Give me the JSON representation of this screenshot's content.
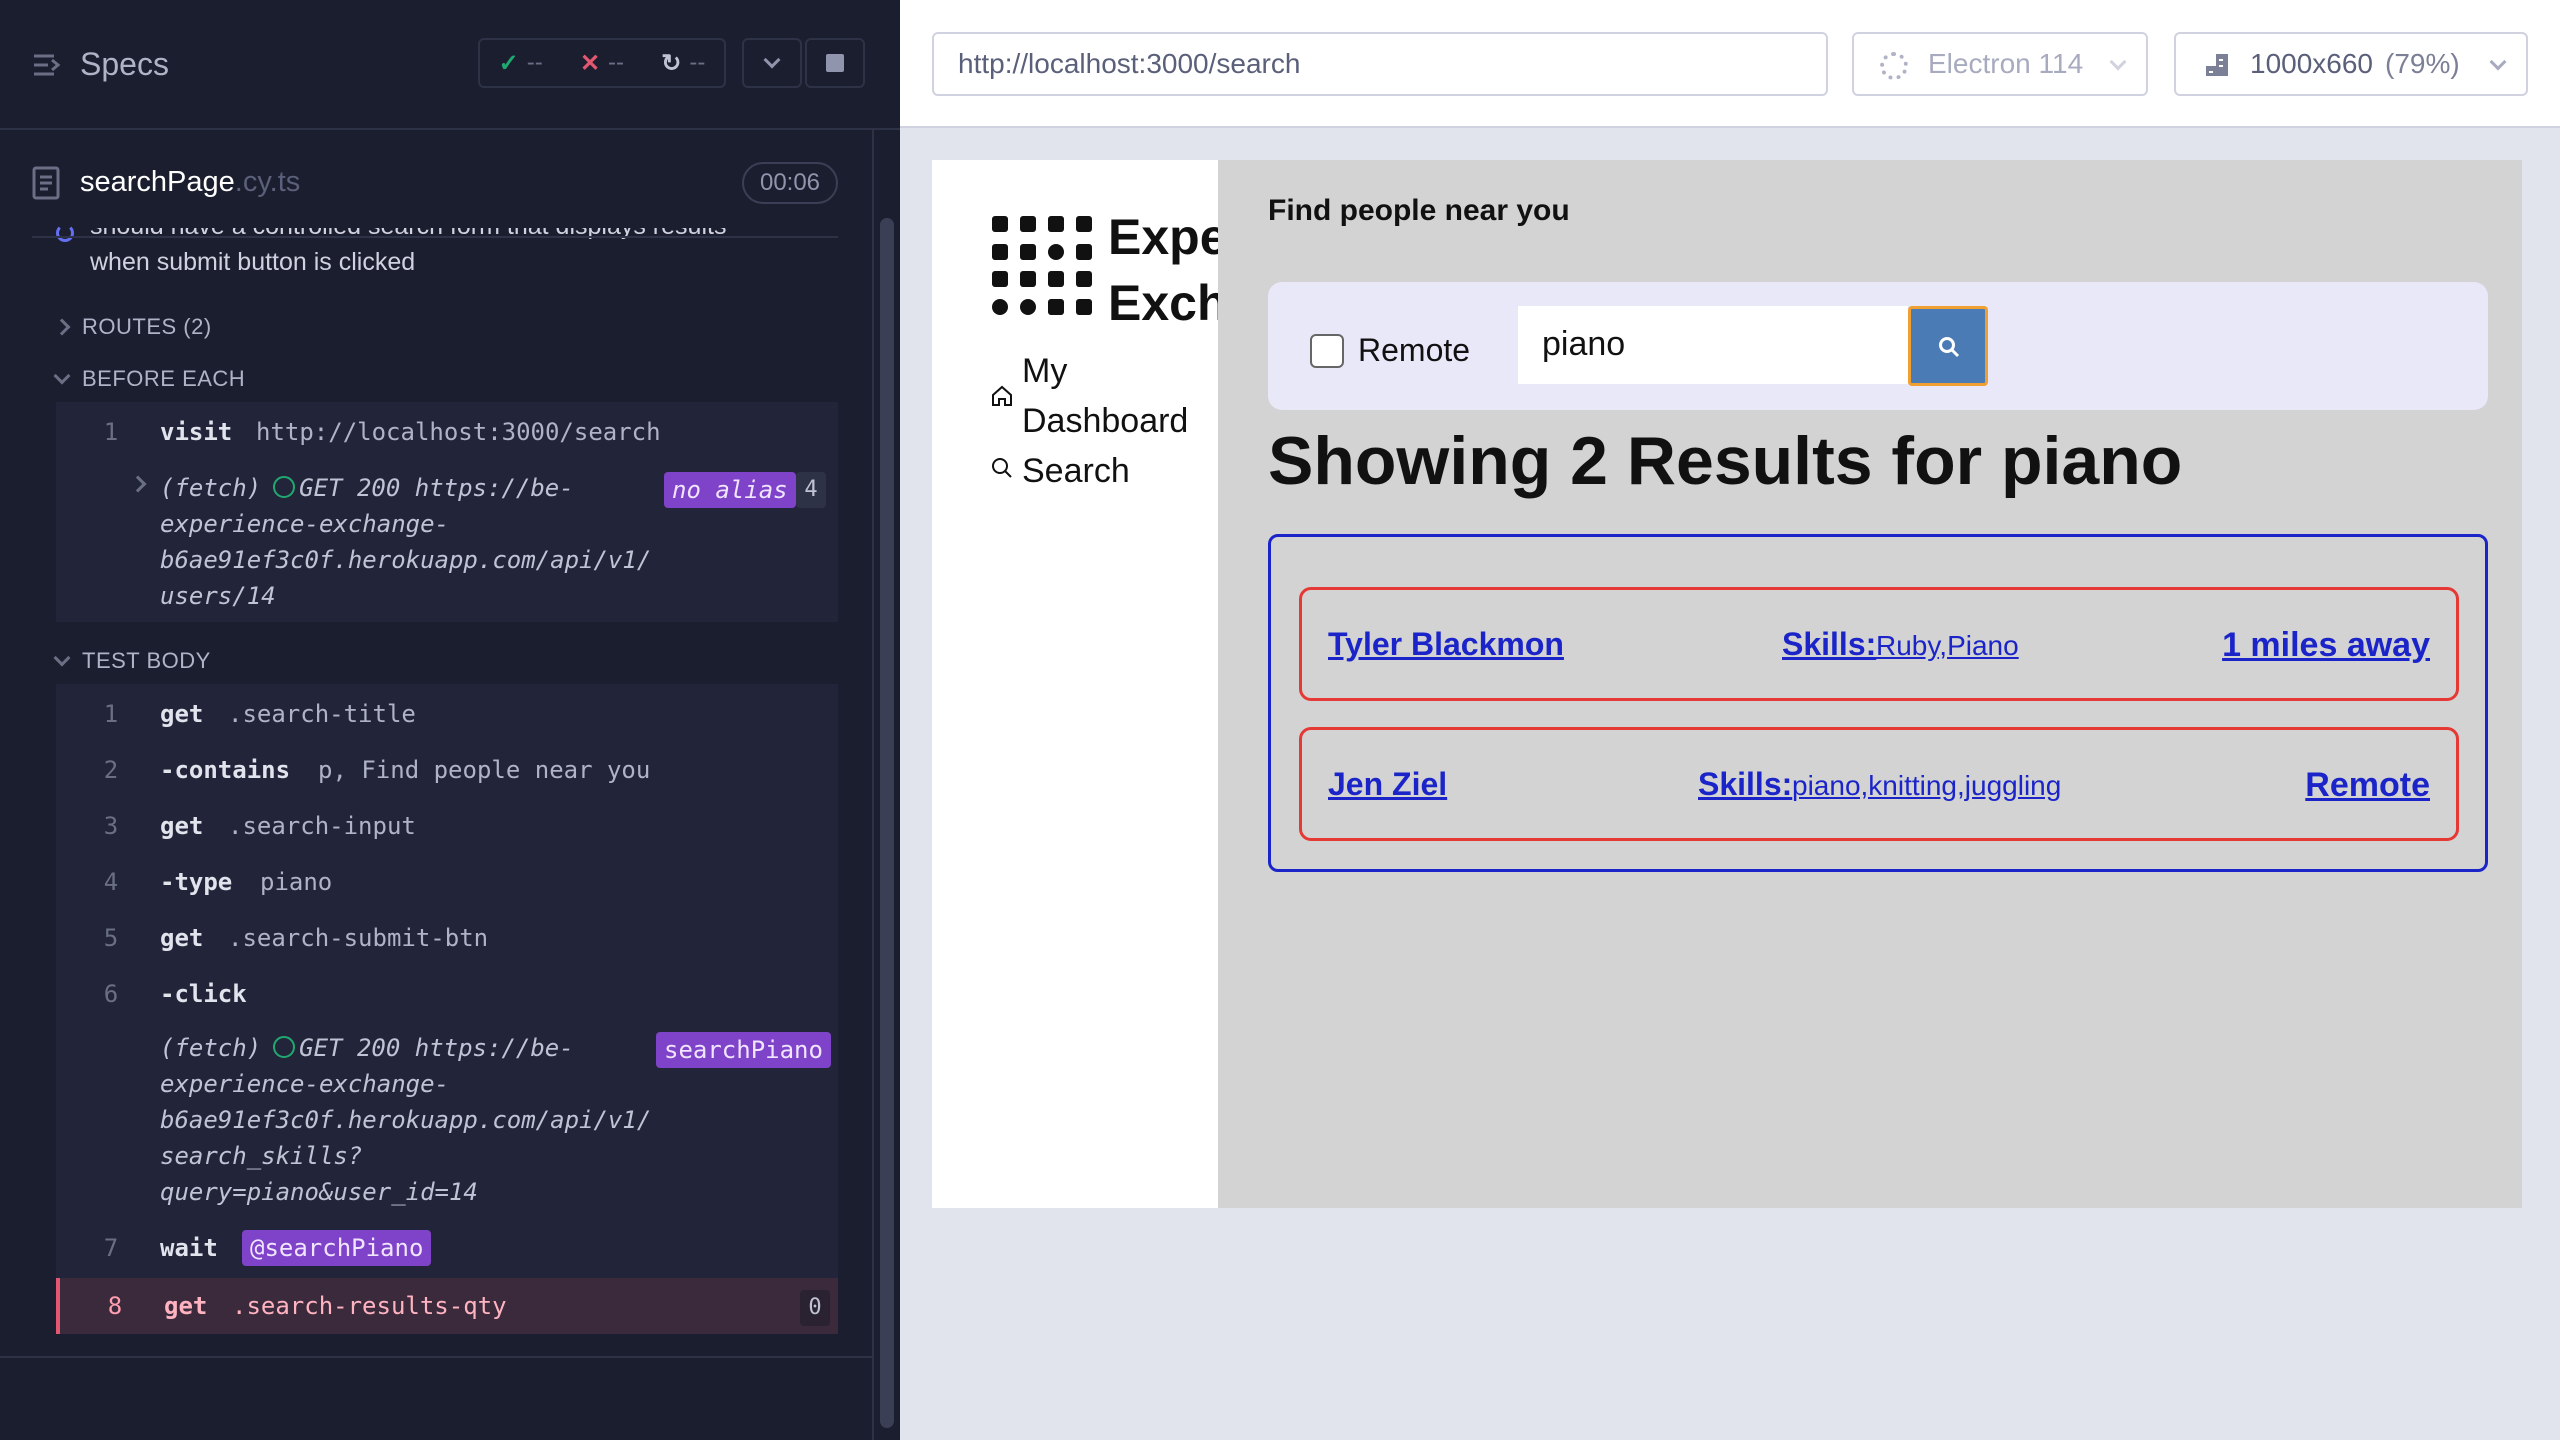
{
  "reporter": {
    "title": "Specs",
    "stats": {
      "passed": "--",
      "failed": "--",
      "pending": "--"
    },
    "spec": {
      "name": "searchPage",
      "ext": ".cy.ts",
      "duration": "00:06"
    },
    "test_title": "should have a controlled search form that displays results when submit button is clicked",
    "routes_label": "ROUTES (2)",
    "before_each_label": "BEFORE EACH",
    "test_body_label": "TEST BODY",
    "before_each": [
      {
        "num": "1",
        "name": "visit",
        "message": "http://localhost:3000/search"
      }
    ],
    "before_fetch": {
      "prefix": "(fetch)",
      "lines": [
        "GET 200 https://be-",
        "experience-exchange-",
        "b6ae91ef3c0f.herokuapp.com/api/v1/",
        "users/14"
      ],
      "alias": "no alias",
      "count": "4"
    },
    "test_body": [
      {
        "num": "1",
        "name": "get",
        "message": ".search-title"
      },
      {
        "num": "2",
        "name": "-contains",
        "message": "p, Find people near you"
      },
      {
        "num": "3",
        "name": "get",
        "message": ".search-input"
      },
      {
        "num": "4",
        "name": "-type",
        "message": "piano"
      },
      {
        "num": "5",
        "name": "get",
        "message": ".search-submit-btn"
      },
      {
        "num": "6",
        "name": "-click",
        "message": ""
      },
      {
        "num": "7",
        "name": "wait",
        "message": "@searchPiano"
      },
      {
        "num": "8",
        "name": "get",
        "message": ".search-results-qty",
        "count": "0"
      }
    ],
    "body_fetch": {
      "prefix": "(fetch)",
      "lines": [
        "GET 200 https://be-",
        "experience-exchange-",
        "b6ae91ef3c0f.herokuapp.com/api/v1/",
        "search_skills?",
        "query=piano&user_id=14"
      ],
      "alias": "searchPiano"
    }
  },
  "header": {
    "url": "http://localhost:3000/search",
    "browser": "Electron 114",
    "viewport": "1000x660",
    "viewport_pct": "(79%)"
  },
  "aut": {
    "logo_line1": "Experience",
    "logo_line2": "Exchange",
    "nav": [
      {
        "label_line1": "My",
        "label_line2": "Dashboard",
        "icon": "home-icon"
      },
      {
        "label": "Search",
        "icon": "search-icon"
      }
    ],
    "subtitle": "Find people near you",
    "remote_label": "Remote",
    "search_value": "piano",
    "results_title": "Showing 2 Results for piano",
    "results": [
      {
        "name": "Tyler Blackmon",
        "skills_label": "Skills:",
        "skills": "Ruby,Piano",
        "distance": "1 miles away"
      },
      {
        "name": "Jen Ziel",
        "skills_label": "Skills:",
        "skills": "piano,knitting,juggling",
        "distance": "Remote"
      }
    ]
  },
  "colors": {
    "reporter_bg": "#1b1e2e",
    "alias_badge": "#7f43c9",
    "failed_accent": "#e45770",
    "passed_accent": "#1fa971",
    "results_border": "#1a24c8",
    "card_border": "#e53935",
    "search_btn": "#4a7bb5"
  }
}
